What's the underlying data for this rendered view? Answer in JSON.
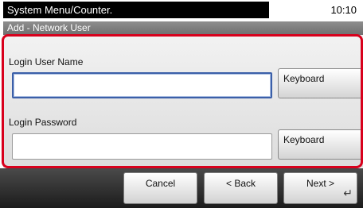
{
  "header": {
    "title": "System Menu/Counter.",
    "time": "10:10"
  },
  "screen": {
    "subtitle": "Add - Network User"
  },
  "form": {
    "username": {
      "label": "Login User Name",
      "value": "",
      "keyboard_label": "Keyboard"
    },
    "password": {
      "label": "Login Password",
      "value": "",
      "keyboard_label": "Keyboard"
    }
  },
  "footer": {
    "cancel_label": "Cancel",
    "back_label": "< Back",
    "next_label": "Next >",
    "enter_icon": "enter-return-icon"
  },
  "colors": {
    "highlight_frame": "#d8001c",
    "focus_border": "#3b5fa8"
  }
}
